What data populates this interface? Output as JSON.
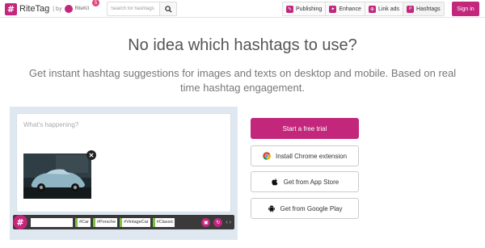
{
  "header": {
    "logo_mark": "#",
    "logo_text": "RiteTag",
    "by_text": "| by",
    "ritekit_text": "RiteKit",
    "notif_count": "5",
    "search_placeholder": "Search for hashtags",
    "nav": [
      {
        "label": "Publishing",
        "icon": "publishing-icon"
      },
      {
        "label": "Enhance",
        "icon": "enhance-icon"
      },
      {
        "label": "Link ads",
        "icon": "link-ads-icon"
      },
      {
        "label": "Hashtags",
        "icon": "hashtags-icon"
      }
    ],
    "signin_label": "Sign in"
  },
  "hero": {
    "title": "No idea which hashtags to use?",
    "subtitle": "Get instant hashtag suggestions for images and texts on desktop and mobile. Based on real time hashtag engagement."
  },
  "demo": {
    "compose_placeholder": "What's happening?",
    "toolbar_logo": "#",
    "tags": [
      "#Car",
      "#Porsche",
      "#VintageCar",
      "#Classic"
    ],
    "tag_color": "#7cc242",
    "nav_arrows": "‹ ›"
  },
  "cta": {
    "trial_label": "Start a free trial",
    "chrome_label": "Install Chrome extension",
    "appstore_label": "Get from App Store",
    "googleplay_label": "Get from Google Play"
  },
  "colors": {
    "brand": "#c2277c",
    "panel_bg": "#dfe8f1"
  }
}
